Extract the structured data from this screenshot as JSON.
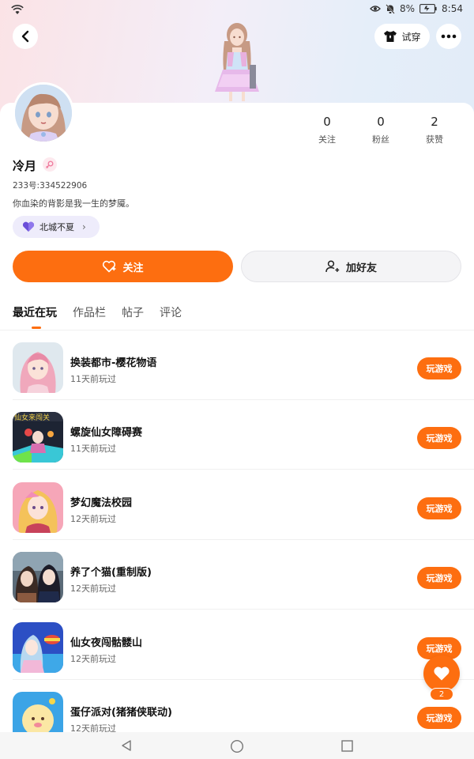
{
  "status_bar": {
    "battery_percent": "8%",
    "time": "8:54"
  },
  "header": {
    "tryon_label": "试穿"
  },
  "profile": {
    "username": "冷月",
    "uid": "233号:334522906",
    "bio": "你血染的背影是我一生的梦魇。",
    "guild": "北城不夏",
    "stats": [
      {
        "value": "0",
        "label": "关注"
      },
      {
        "value": "0",
        "label": "粉丝"
      },
      {
        "value": "2",
        "label": "获赞"
      }
    ]
  },
  "actions": {
    "follow_label": "关注",
    "add_friend_label": "加好友"
  },
  "tabs": [
    {
      "label": "最近在玩",
      "active": true
    },
    {
      "label": "作品栏",
      "active": false
    },
    {
      "label": "帖子",
      "active": false
    },
    {
      "label": "评论",
      "active": false
    }
  ],
  "games": [
    {
      "title": "换装都市-樱花物语",
      "last_played": "11天前玩过",
      "play_label": "玩游戏"
    },
    {
      "title": "螺旋仙女障碍赛",
      "last_played": "11天前玩过",
      "play_label": "玩游戏"
    },
    {
      "title": "梦幻魔法校园",
      "last_played": "12天前玩过",
      "play_label": "玩游戏"
    },
    {
      "title": "养了个猫(重制版)",
      "last_played": "12天前玩过",
      "play_label": "玩游戏"
    },
    {
      "title": "仙女夜闯骷髅山",
      "last_played": "12天前玩过",
      "play_label": "玩游戏"
    },
    {
      "title": "蛋仔派对(猪猪侠联动)",
      "last_played": "12天前玩过",
      "play_label": "玩游戏"
    }
  ],
  "like_fab": {
    "count": "2"
  },
  "colors": {
    "accent": "#fd6e10",
    "chip_bg": "#eeecfb"
  }
}
